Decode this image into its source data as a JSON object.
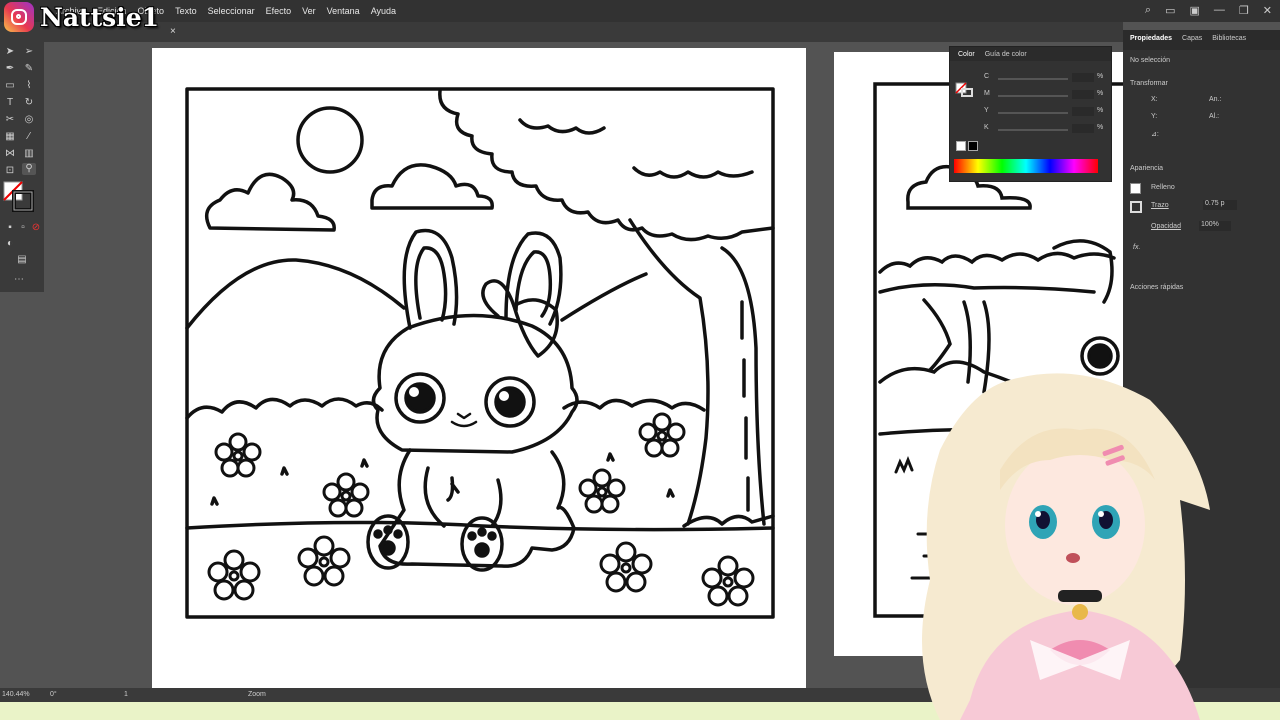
{
  "streamer": {
    "name": "Nattsie1"
  },
  "menu": [
    "Archivo",
    "Edición",
    "Objeto",
    "Texto",
    "Seleccionar",
    "Efecto",
    "Ver",
    "Ventana",
    "Ayuda"
  ],
  "doc_tab": {
    "close": "×"
  },
  "color_panel": {
    "tabs": [
      "Color",
      "Guía de color"
    ],
    "channels": [
      {
        "label": "C",
        "unit": "%"
      },
      {
        "label": "M",
        "unit": "%"
      },
      {
        "label": "Y",
        "unit": "%"
      },
      {
        "label": "K",
        "unit": "%"
      }
    ]
  },
  "properties": {
    "tabs": [
      "Propiedades",
      "Capas",
      "Bibliotecas"
    ],
    "no_selection": "No selección",
    "transform": "Transformar",
    "fields": {
      "x": "X:",
      "y": "Y:",
      "w": "An.:",
      "h": "Al.:",
      "angle": "⊿:"
    },
    "appearance": "Apariencia",
    "fill_label": "Relleno",
    "stroke_label": "Trazo",
    "stroke_value": "0.75 p",
    "opacity_label": "Opacidad",
    "opacity_value": "100%",
    "fx": "fx.",
    "quick_actions": "Acciones rápidas"
  },
  "status": {
    "zoom": "140.44%",
    "rotation": "0°",
    "artboard": "1",
    "tool": "Zoom"
  },
  "colors": {
    "ui_dark": "#323232",
    "ui_mid": "#3a3a3a",
    "canvas": "#535353",
    "bottom_strip": "#eaf3c8"
  }
}
